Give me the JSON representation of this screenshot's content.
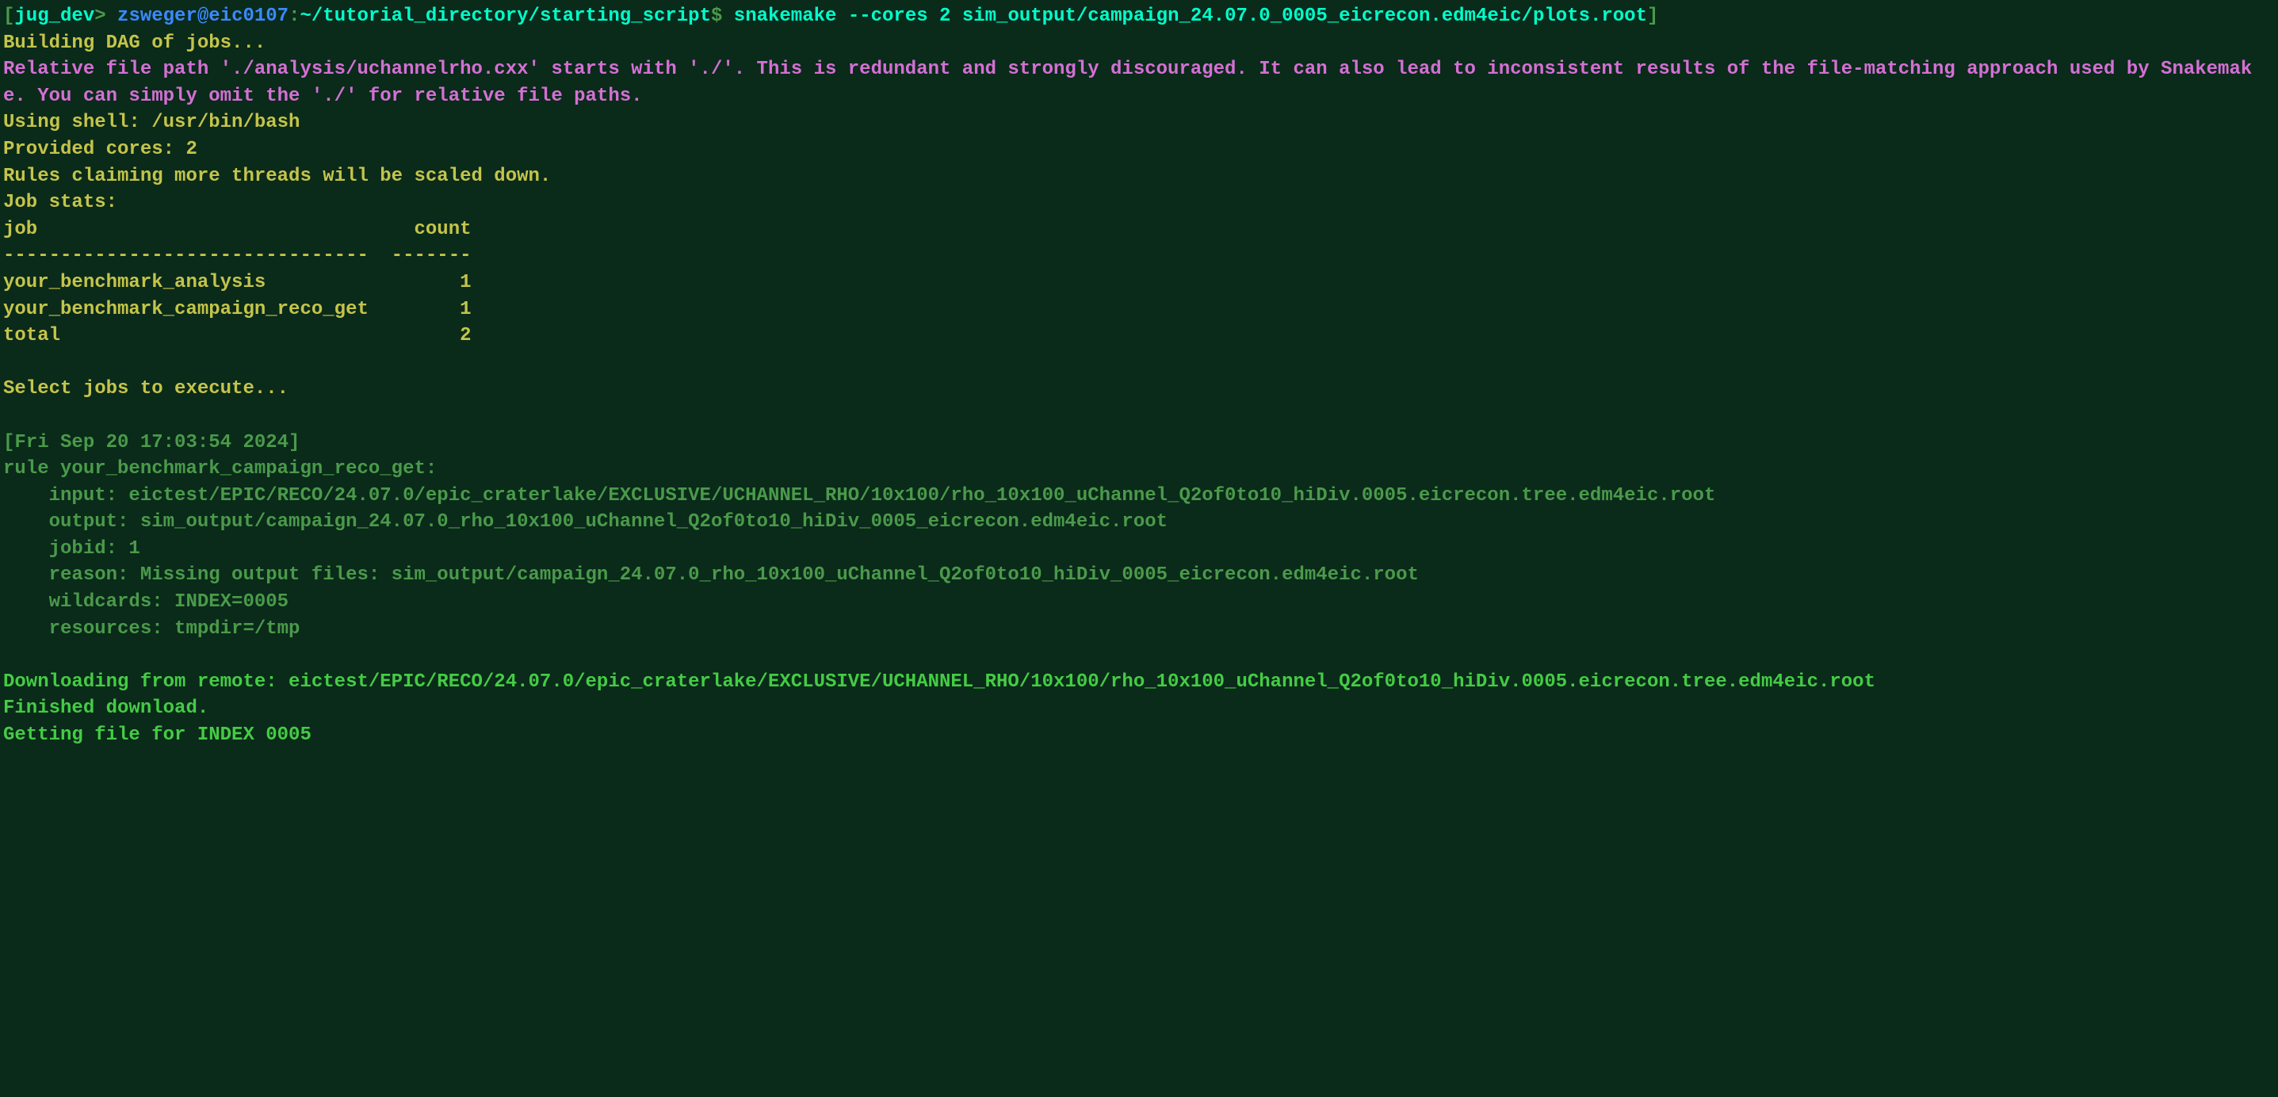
{
  "prompt": {
    "host": "jug_dev",
    "user_host": "zsweger@eic0107",
    "path": "~/tutorial_directory/starting_script",
    "dollar": "$ ",
    "command": "snakemake --cores 2 sim_output/campaign_24.07.0_0005_eicrecon.edm4eic/plots.root"
  },
  "output": {
    "building_dag": "Building DAG of jobs...",
    "warning": "Relative file path './analysis/uchannelrho.cxx' starts with './'. This is redundant and strongly discouraged. It can also lead to inconsistent results of the file-matching approach used by Snakemake. You can simply omit the './' for relative file paths.",
    "using_shell": "Using shell: /usr/bin/bash",
    "provided_cores": "Provided cores: 2",
    "rules_claiming": "Rules claiming more threads will be scaled down.",
    "job_stats_header": "Job stats:",
    "table_header": "job                                 count",
    "table_divider": "--------------------------------  -------",
    "table_row1": "your_benchmark_analysis                 1",
    "table_row2": "your_benchmark_campaign_reco_get        1",
    "table_row3": "total                                   2",
    "select_jobs": "Select jobs to execute...",
    "timestamp": "[Fri Sep 20 17:03:54 2024]",
    "rule_name": "rule your_benchmark_campaign_reco_get:",
    "rule_input": "    input: eictest/EPIC/RECO/24.07.0/epic_craterlake/EXCLUSIVE/UCHANNEL_RHO/10x100/rho_10x100_uChannel_Q2of0to10_hiDiv.0005.eicrecon.tree.edm4eic.root",
    "rule_output": "    output: sim_output/campaign_24.07.0_rho_10x100_uChannel_Q2of0to10_hiDiv_0005_eicrecon.edm4eic.root",
    "rule_jobid": "    jobid: 1",
    "rule_reason": "    reason: Missing output files: sim_output/campaign_24.07.0_rho_10x100_uChannel_Q2of0to10_hiDiv_0005_eicrecon.edm4eic.root",
    "rule_wildcards": "    wildcards: INDEX=0005",
    "rule_resources": "    resources: tmpdir=/tmp",
    "downloading": "Downloading from remote: eictest/EPIC/RECO/24.07.0/epic_craterlake/EXCLUSIVE/UCHANNEL_RHO/10x100/rho_10x100_uChannel_Q2of0to10_hiDiv.0005.eicrecon.tree.edm4eic.root",
    "finished_download": "Finished download.",
    "getting_file": "Getting file for INDEX 0005"
  }
}
